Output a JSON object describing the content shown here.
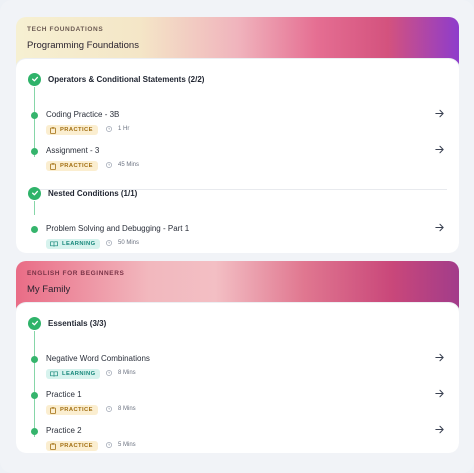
{
  "colors": {
    "check_green": "#2fb36a",
    "practice_bg": "#fbeed0",
    "practice_text": "#a26f12",
    "learning_bg": "#d7f3ee",
    "learning_text": "#17877a"
  },
  "courses": [
    {
      "tag": "TECH FOUNDATIONS",
      "title": "Programming Foundations",
      "sections": [
        {
          "title": "Operators & Conditional Statements (2/2)",
          "items": [
            {
              "title": "Coding Practice - 3B",
              "badge": "PRACTICE",
              "duration": "1 Hr",
              "icon": "clipboard-icon"
            },
            {
              "title": "Assignment - 3",
              "badge": "PRACTICE",
              "duration": "45 Mins",
              "icon": "clipboard-icon"
            }
          ]
        },
        {
          "title": "Nested Conditions (1/1)",
          "items": [
            {
              "title": "Problem Solving and Debugging - Part 1",
              "badge": "LEARNING",
              "duration": "50 Mins",
              "icon": "book-icon"
            }
          ]
        }
      ]
    },
    {
      "tag": "ENGLISH FOR BEGINNERS",
      "title": "My Family",
      "sections": [
        {
          "title": "Essentials (3/3)",
          "items": [
            {
              "title": "Negative Word Combinations",
              "badge": "LEARNING",
              "duration": "8 Mins",
              "icon": "book-icon"
            },
            {
              "title": "Practice 1",
              "badge": "PRACTICE",
              "duration": "8 Mins",
              "icon": "clipboard-icon"
            },
            {
              "title": "Practice 2",
              "badge": "PRACTICE",
              "duration": "5 Mins",
              "icon": "clipboard-icon"
            }
          ]
        }
      ]
    }
  ]
}
